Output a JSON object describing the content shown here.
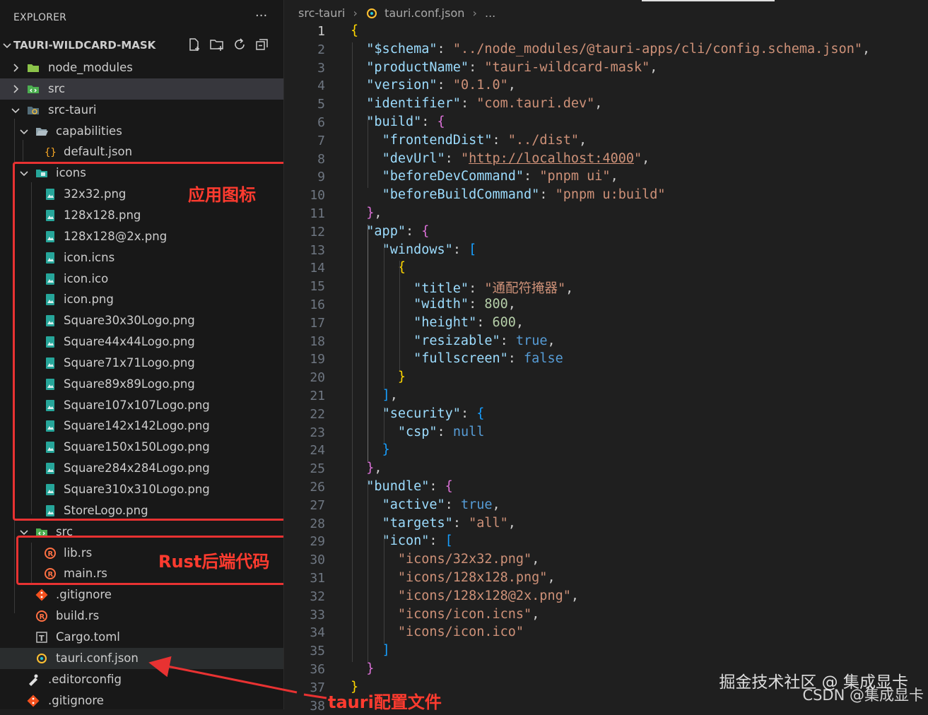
{
  "sidebar": {
    "title": "EXPLORER",
    "more": "···",
    "project": "TAURI-WILDCARD-MASK",
    "items": [
      {
        "label": "node_modules"
      },
      {
        "label": "src"
      },
      {
        "label": "src-tauri"
      },
      {
        "label": "capabilities"
      },
      {
        "label": "default.json"
      },
      {
        "label": "icons"
      },
      {
        "label": "32x32.png"
      },
      {
        "label": "128x128.png"
      },
      {
        "label": "128x128@2x.png"
      },
      {
        "label": "icon.icns"
      },
      {
        "label": "icon.ico"
      },
      {
        "label": "icon.png"
      },
      {
        "label": "Square30x30Logo.png"
      },
      {
        "label": "Square44x44Logo.png"
      },
      {
        "label": "Square71x71Logo.png"
      },
      {
        "label": "Square89x89Logo.png"
      },
      {
        "label": "Square107x107Logo.png"
      },
      {
        "label": "Square142x142Logo.png"
      },
      {
        "label": "Square150x150Logo.png"
      },
      {
        "label": "Square284x284Logo.png"
      },
      {
        "label": "Square310x310Logo.png"
      },
      {
        "label": "StoreLogo.png"
      },
      {
        "label": "src"
      },
      {
        "label": "lib.rs"
      },
      {
        "label": "main.rs"
      },
      {
        "label": ".gitignore"
      },
      {
        "label": "build.rs"
      },
      {
        "label": "Cargo.toml"
      },
      {
        "label": "tauri.conf.json"
      },
      {
        "label": ".editorconfig"
      },
      {
        "label": ".gitignore"
      }
    ]
  },
  "breadcrumb": {
    "folder": "src-tauri",
    "sep": "›",
    "file": "tauri.conf.json",
    "rest": "..."
  },
  "code": {
    "line_numbers": [
      "1",
      "2",
      "3",
      "4",
      "5",
      "6",
      "7",
      "8",
      "9",
      "10",
      "11",
      "12",
      "13",
      "14",
      "15",
      "16",
      "17",
      "18",
      "19",
      "20",
      "21",
      "22",
      "23",
      "24",
      "25",
      "26",
      "27",
      "28",
      "29",
      "30",
      "31",
      "32",
      "33",
      "34",
      "35",
      "36",
      "37",
      "38"
    ],
    "lines": [
      [
        [
          "br1",
          "{"
        ]
      ],
      [
        [
          "p",
          "  "
        ],
        [
          "k",
          "\"$schema\""
        ],
        [
          "p",
          ": "
        ],
        [
          "s",
          "\"../node_modules/@tauri-apps/cli/config.schema.json\""
        ],
        [
          "p",
          ","
        ]
      ],
      [
        [
          "p",
          "  "
        ],
        [
          "k",
          "\"productName\""
        ],
        [
          "p",
          ": "
        ],
        [
          "s",
          "\"tauri-wildcard-mask\""
        ],
        [
          "p",
          ","
        ]
      ],
      [
        [
          "p",
          "  "
        ],
        [
          "k",
          "\"version\""
        ],
        [
          "p",
          ": "
        ],
        [
          "s",
          "\"0.1.0\""
        ],
        [
          "p",
          ","
        ]
      ],
      [
        [
          "p",
          "  "
        ],
        [
          "k",
          "\"identifier\""
        ],
        [
          "p",
          ": "
        ],
        [
          "s",
          "\"com.tauri.dev\""
        ],
        [
          "p",
          ","
        ]
      ],
      [
        [
          "p",
          "  "
        ],
        [
          "k",
          "\"build\""
        ],
        [
          "p",
          ": "
        ],
        [
          "br2",
          "{"
        ]
      ],
      [
        [
          "p",
          "    "
        ],
        [
          "k",
          "\"frontendDist\""
        ],
        [
          "p",
          ": "
        ],
        [
          "s",
          "\"../dist\""
        ],
        [
          "p",
          ","
        ]
      ],
      [
        [
          "p",
          "    "
        ],
        [
          "k",
          "\"devUrl\""
        ],
        [
          "p",
          ": "
        ],
        [
          "s",
          "\""
        ],
        [
          "su",
          "http://localhost:4000"
        ],
        [
          "s",
          "\""
        ],
        [
          "p",
          ","
        ]
      ],
      [
        [
          "p",
          "    "
        ],
        [
          "k",
          "\"beforeDevCommand\""
        ],
        [
          "p",
          ": "
        ],
        [
          "s",
          "\"pnpm ui\""
        ],
        [
          "p",
          ","
        ]
      ],
      [
        [
          "p",
          "    "
        ],
        [
          "k",
          "\"beforeBuildCommand\""
        ],
        [
          "p",
          ": "
        ],
        [
          "s",
          "\"pnpm u:build\""
        ]
      ],
      [
        [
          "p",
          "  "
        ],
        [
          "br2",
          "}"
        ],
        [
          "p",
          ","
        ]
      ],
      [
        [
          "p",
          "  "
        ],
        [
          "k",
          "\"app\""
        ],
        [
          "p",
          ": "
        ],
        [
          "br2",
          "{"
        ]
      ],
      [
        [
          "p",
          "    "
        ],
        [
          "k",
          "\"windows\""
        ],
        [
          "p",
          ": "
        ],
        [
          "br3",
          "["
        ]
      ],
      [
        [
          "p",
          "      "
        ],
        [
          "br1",
          "{"
        ]
      ],
      [
        [
          "p",
          "        "
        ],
        [
          "k",
          "\"title\""
        ],
        [
          "p",
          ": "
        ],
        [
          "s",
          "\"通配符掩器\""
        ],
        [
          "p",
          ","
        ]
      ],
      [
        [
          "p",
          "        "
        ],
        [
          "k",
          "\"width\""
        ],
        [
          "p",
          ": "
        ],
        [
          "n",
          "800"
        ],
        [
          "p",
          ","
        ]
      ],
      [
        [
          "p",
          "        "
        ],
        [
          "k",
          "\"height\""
        ],
        [
          "p",
          ": "
        ],
        [
          "n",
          "600"
        ],
        [
          "p",
          ","
        ]
      ],
      [
        [
          "p",
          "        "
        ],
        [
          "k",
          "\"resizable\""
        ],
        [
          "p",
          ": "
        ],
        [
          "b",
          "true"
        ],
        [
          "p",
          ","
        ]
      ],
      [
        [
          "p",
          "        "
        ],
        [
          "k",
          "\"fullscreen\""
        ],
        [
          "p",
          ": "
        ],
        [
          "b",
          "false"
        ]
      ],
      [
        [
          "p",
          "      "
        ],
        [
          "br1",
          "}"
        ]
      ],
      [
        [
          "p",
          "    "
        ],
        [
          "br3",
          "]"
        ],
        [
          "p",
          ","
        ]
      ],
      [
        [
          "p",
          "    "
        ],
        [
          "k",
          "\"security\""
        ],
        [
          "p",
          ": "
        ],
        [
          "br3",
          "{"
        ]
      ],
      [
        [
          "p",
          "      "
        ],
        [
          "k",
          "\"csp\""
        ],
        [
          "p",
          ": "
        ],
        [
          "b",
          "null"
        ]
      ],
      [
        [
          "p",
          "    "
        ],
        [
          "br3",
          "}"
        ]
      ],
      [
        [
          "p",
          "  "
        ],
        [
          "br2",
          "}"
        ],
        [
          "p",
          ","
        ]
      ],
      [
        [
          "p",
          "  "
        ],
        [
          "k",
          "\"bundle\""
        ],
        [
          "p",
          ": "
        ],
        [
          "br2",
          "{"
        ]
      ],
      [
        [
          "p",
          "    "
        ],
        [
          "k",
          "\"active\""
        ],
        [
          "p",
          ": "
        ],
        [
          "b",
          "true"
        ],
        [
          "p",
          ","
        ]
      ],
      [
        [
          "p",
          "    "
        ],
        [
          "k",
          "\"targets\""
        ],
        [
          "p",
          ": "
        ],
        [
          "s",
          "\"all\""
        ],
        [
          "p",
          ","
        ]
      ],
      [
        [
          "p",
          "    "
        ],
        [
          "k",
          "\"icon\""
        ],
        [
          "p",
          ": "
        ],
        [
          "br3",
          "["
        ]
      ],
      [
        [
          "p",
          "      "
        ],
        [
          "s",
          "\"icons/32x32.png\""
        ],
        [
          "p",
          ","
        ]
      ],
      [
        [
          "p",
          "      "
        ],
        [
          "s",
          "\"icons/128x128.png\""
        ],
        [
          "p",
          ","
        ]
      ],
      [
        [
          "p",
          "      "
        ],
        [
          "s",
          "\"icons/128x128@2x.png\""
        ],
        [
          "p",
          ","
        ]
      ],
      [
        [
          "p",
          "      "
        ],
        [
          "s",
          "\"icons/icon.icns\""
        ],
        [
          "p",
          ","
        ]
      ],
      [
        [
          "p",
          "      "
        ],
        [
          "s",
          "\"icons/icon.ico\""
        ]
      ],
      [
        [
          "p",
          "    "
        ],
        [
          "br3",
          "]"
        ]
      ],
      [
        [
          "p",
          "  "
        ],
        [
          "br2",
          "}"
        ]
      ],
      [
        [
          "br1",
          "}"
        ]
      ],
      [
        [
          "p",
          ""
        ]
      ]
    ]
  },
  "annotations": {
    "icons_label": "应用图标",
    "rust_label": "Rust后端代码",
    "config_label": "tauri配置文件",
    "color": "#e83232"
  },
  "watermark": {
    "line1": "掘金技术社区 @ 集成显卡",
    "line2": "CSDN @集成显卡"
  },
  "colors": {
    "background": "#1f1f1f",
    "sidebar": "#181818",
    "selected_row": "#37373d",
    "accent_annotation": "#e83232"
  }
}
